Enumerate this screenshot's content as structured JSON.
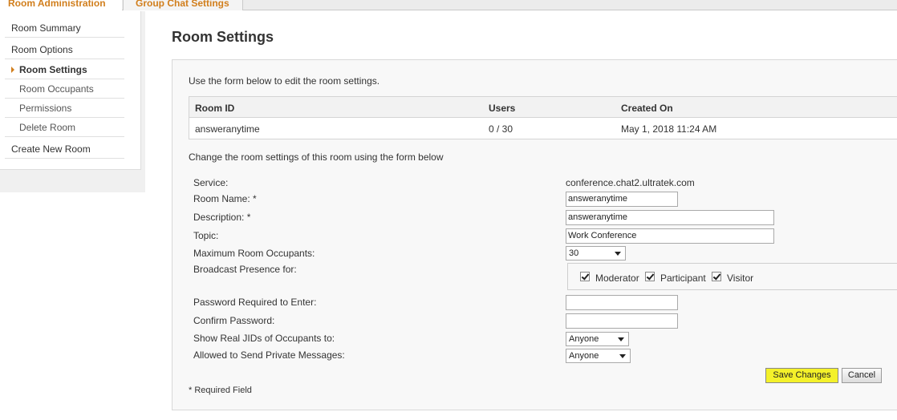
{
  "tabs": [
    "Room Administration",
    "Group Chat Settings"
  ],
  "sidebar": {
    "items": [
      {
        "label": "Room Summary"
      },
      {
        "label": "Room Options"
      },
      {
        "label": "Room Settings"
      },
      {
        "label": "Room Occupants"
      },
      {
        "label": "Permissions"
      },
      {
        "label": "Delete Room"
      },
      {
        "label": "Create New Room"
      }
    ]
  },
  "main": {
    "title": "Room Settings",
    "intro": "Use the form below to edit the room settings.",
    "table": {
      "headers": [
        "Room ID",
        "Users",
        "Created On"
      ],
      "row": [
        "answeranytime",
        "0 / 30",
        "May 1, 2018 11:24 AM"
      ]
    },
    "change_note": "Change the room settings of this room using the form below",
    "form": {
      "service_label": "Service:",
      "service_value": "conference.chat2.ultratek.com",
      "room_name_label": "Room Name: *",
      "room_name_value": "answeranytime",
      "description_label": "Description: *",
      "description_value": "answeranytime",
      "topic_label": "Topic:",
      "topic_value": "Work Conference",
      "max_occupants_label": "Maximum Room Occupants:",
      "max_occupants_value": "30",
      "broadcast_label": "Broadcast Presence for:",
      "broadcast": [
        {
          "label": "Moderator",
          "checked": true
        },
        {
          "label": "Participant",
          "checked": true
        },
        {
          "label": "Visitor",
          "checked": true
        }
      ],
      "password_label": "Password Required to Enter:",
      "password_value": "",
      "confirm_label": "Confirm Password:",
      "confirm_value": "",
      "real_jids_label": "Show Real JIDs of Occupants to:",
      "real_jids_value": "Anyone",
      "private_msg_label": "Allowed to Send Private Messages:",
      "private_msg_value": "Anyone"
    },
    "buttons": {
      "save": "Save Changes",
      "cancel": "Cancel"
    },
    "required_note": "* Required Field"
  },
  "colors": {
    "accent": "#d17e1c",
    "highlight": "#f4f12a"
  }
}
